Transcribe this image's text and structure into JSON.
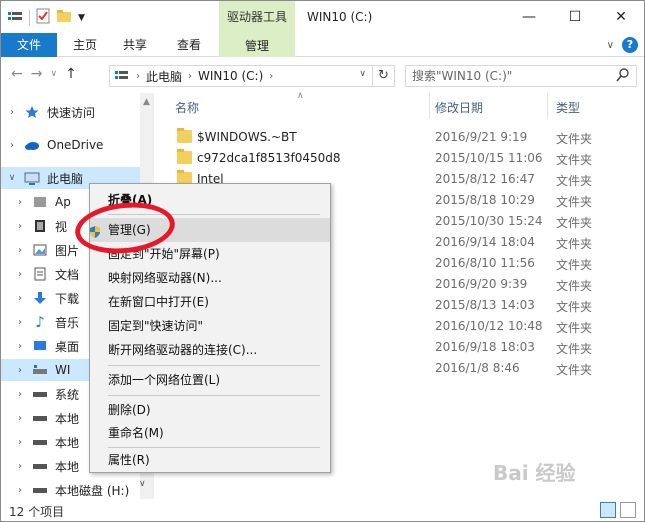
{
  "window": {
    "title": "WIN10 (C:)",
    "context_tab_title": "驱动器工具"
  },
  "ribbon": {
    "tabs": {
      "file": "文件",
      "home": "主页",
      "share": "共享",
      "view": "查看",
      "manage": "管理"
    }
  },
  "address": {
    "segments": [
      "此电脑",
      "WIN10 (C:)"
    ],
    "search_placeholder": "搜索\"WIN10 (C:)\""
  },
  "nav": {
    "quick_access": "快速访问",
    "onedrive": "OneDrive",
    "this_pc": "此电脑",
    "items": [
      "Ap",
      "视",
      "图片",
      "文档",
      "下载",
      "音乐",
      "桌面",
      "WI",
      "系统",
      "本地",
      "本地",
      "本地",
      "本地磁盘 (H:)"
    ]
  },
  "columns": {
    "name": "名称",
    "date": "修改日期",
    "type": "类型"
  },
  "files": [
    {
      "name": "$WINDOWS.~BT",
      "date": "2016/9/21 9:19",
      "type": "文件夹"
    },
    {
      "name": "c972dca1f8513f0450d8",
      "date": "2015/10/15 11:06",
      "type": "文件夹"
    },
    {
      "name": "Intel",
      "date": "2015/8/12 16:47",
      "type": "文件夹"
    },
    {
      "name": "",
      "date": "2015/8/18 10:29",
      "type": "文件夹"
    },
    {
      "name": "",
      "date": "2015/10/30 15:24",
      "type": "文件夹"
    },
    {
      "name": "",
      "date": "2016/9/14 18:04",
      "type": "文件夹"
    },
    {
      "name": "",
      "date": "2016/8/10 11:56",
      "type": "文件夹"
    },
    {
      "name": "",
      "date": "2016/9/20 9:39",
      "type": "文件夹"
    },
    {
      "name": "",
      "date": "2015/8/13 14:03",
      "type": "文件夹"
    },
    {
      "name": "",
      "date": "2016/10/12 10:48",
      "type": "文件夹"
    },
    {
      "name": "",
      "date": "2016/9/18 18:03",
      "type": "文件夹"
    },
    {
      "name": "",
      "date": "2016/1/8 8:46",
      "type": "文件夹"
    }
  ],
  "context_menu": {
    "collapse": "折叠(A)",
    "manage": "管理(G)",
    "pin_start": "固定到\"开始\"屏幕(P)",
    "map_drive": "映射网络驱动器(N)...",
    "open_new": "在新窗口中打开(E)",
    "pin_quick": "固定到\"快速访问\"",
    "disconnect": "断开网络驱动器的连接(C)...",
    "add_location": "添加一个网络位置(L)",
    "delete": "删除(D)",
    "rename": "重命名(M)",
    "properties": "属性(R)"
  },
  "status": {
    "count": "12 个项目"
  },
  "watermark": "Bai 经验",
  "colors": {
    "accent": "#1979ca",
    "context_tab": "#dbeec6",
    "annotation": "#e8182a"
  }
}
